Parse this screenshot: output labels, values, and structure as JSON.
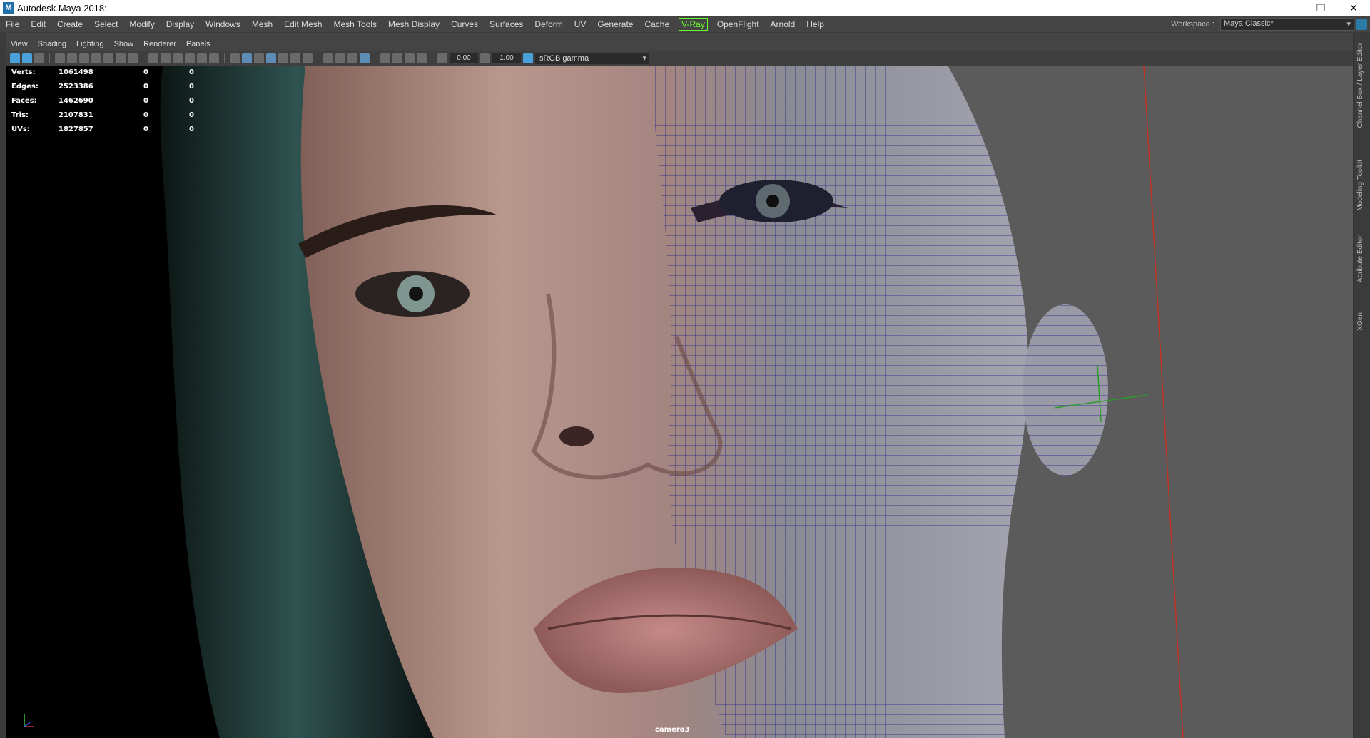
{
  "title_bar": {
    "title": "Autodesk Maya 2018:",
    "logo_letter": "M",
    "minimize": "—",
    "maximize": "❐",
    "close": "✕"
  },
  "menu": {
    "items": [
      "File",
      "Edit",
      "Create",
      "Select",
      "Modify",
      "Display",
      "Windows",
      "Mesh",
      "Edit Mesh",
      "Mesh Tools",
      "Mesh Display",
      "Curves",
      "Surfaces",
      "Deform",
      "UV",
      "Generate",
      "Cache",
      "V-Ray",
      "OpenFlight",
      "Arnold",
      "Help"
    ],
    "workspace_label": "Workspace :",
    "workspace_value": "Maya Classic*"
  },
  "panel_menu": {
    "items": [
      "View",
      "Shading",
      "Lighting",
      "Show",
      "Renderer",
      "Panels"
    ]
  },
  "viewport_toolbar": {
    "exposure": "0.00",
    "gamma": "1.00",
    "color_space": "sRGB gamma"
  },
  "hud": {
    "rows": [
      {
        "label": "Verts:",
        "value": "1061498",
        "z1": "0",
        "z2": "0"
      },
      {
        "label": "Edges:",
        "value": "2523386",
        "z1": "0",
        "z2": "0"
      },
      {
        "label": "Faces:",
        "value": "1462690",
        "z1": "0",
        "z2": "0"
      },
      {
        "label": "Tris:",
        "value": "2107831",
        "z1": "0",
        "z2": "0"
      },
      {
        "label": "UVs:",
        "value": "1827857",
        "z1": "0",
        "z2": "0"
      }
    ],
    "camera": "camera3"
  },
  "right_dock": {
    "tabs": [
      "Channel Box / Layer Editor",
      "Modeling Toolkit",
      "Attribute Editor",
      "XGen"
    ]
  },
  "colors": {
    "wireframe": "#1a1a8c",
    "vray_accent": "#6bff2a",
    "ui_dark": "#444444",
    "ui_field": "#2b2b2b"
  }
}
